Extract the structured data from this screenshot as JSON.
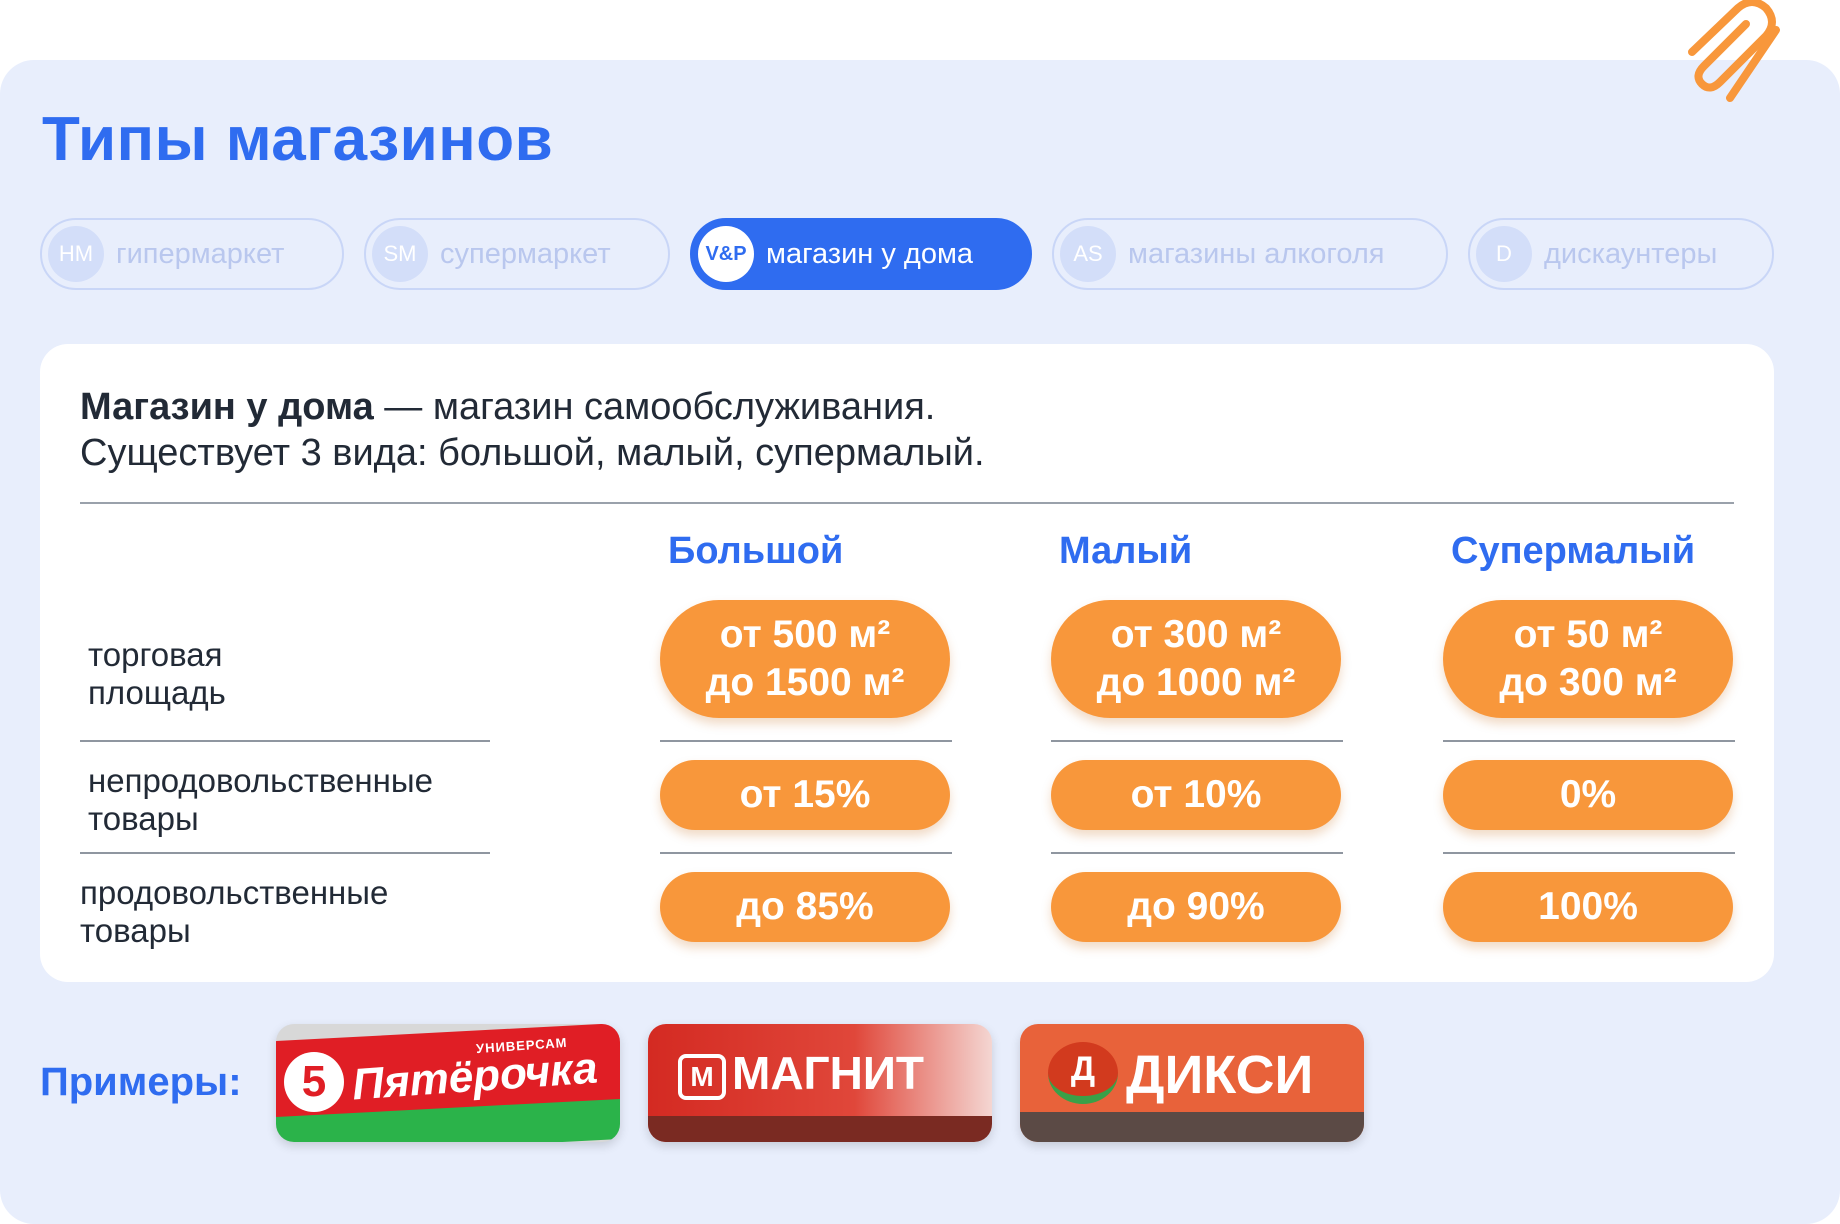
{
  "title": "Типы магазинов",
  "tabs": [
    {
      "abbr": "HM",
      "label": "гипермаркет",
      "active": false
    },
    {
      "abbr": "SM",
      "label": "супермаркет",
      "active": false
    },
    {
      "abbr": "V&P",
      "label": "магазин у дома",
      "active": true
    },
    {
      "abbr": "AS",
      "label": "магазины алкоголя",
      "active": false
    },
    {
      "abbr": "D",
      "label": "дискаунтеры",
      "active": false
    }
  ],
  "card": {
    "term": "Магазин у дома",
    "definition": " — магазин самообслуживания.",
    "line2": "Существует 3 вида: большой, малый, супермалый.",
    "columns": [
      "Большой",
      "Малый",
      "Супермалый"
    ],
    "row_labels": [
      {
        "line1": "торговая",
        "line2": "площадь"
      },
      {
        "line1": "непродовольственные",
        "line2": "товары"
      },
      {
        "line1": "продовольственные",
        "line2": "товары"
      }
    ],
    "area": [
      {
        "from": "от 500 м²",
        "to": "до 1500 м²"
      },
      {
        "from": "от 300 м²",
        "to": "до 1000 м²"
      },
      {
        "from": "от 50 м²",
        "to": "до 300 м²"
      }
    ],
    "non_food": [
      "от 15%",
      "от 10%",
      "0%"
    ],
    "food": [
      "до 85%",
      "до 90%",
      "100%"
    ]
  },
  "examples": {
    "label": "Примеры:",
    "logos": [
      {
        "name": "Пятёрочка",
        "tag": "УНИВЕРСАМ",
        "mark": "5"
      },
      {
        "name": "МАГНИТ",
        "mark": "М"
      },
      {
        "name": "ДИКСИ",
        "mark": "Д"
      }
    ]
  },
  "colors": {
    "accent": "#2f6cf0",
    "pill": "#f8973b",
    "panel": "#e8eefc"
  },
  "icons": {
    "corner": "paperclip-icon"
  }
}
